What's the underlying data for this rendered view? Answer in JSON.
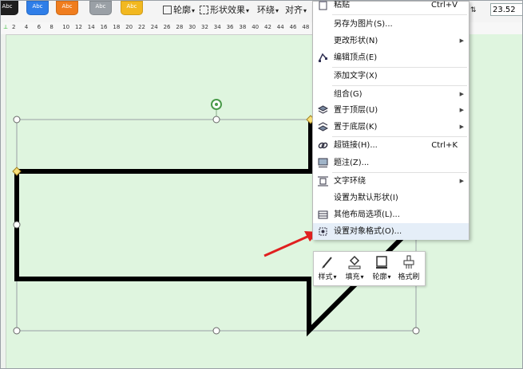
{
  "toolbar": {
    "style_swatches": [
      {
        "label": "Abc",
        "color": "#1e1e1e"
      },
      {
        "label": "Abc",
        "color": "#2f7ee8"
      },
      {
        "label": "Abc",
        "color": "#f07d1e"
      },
      {
        "label": "Abc",
        "color": "#9aa0a6"
      },
      {
        "label": "Abc",
        "color": "#f2b820"
      }
    ],
    "outline_label": "轮廓",
    "shape_effects_label": "形状效果",
    "wrap_label": "环绕",
    "align_label": "对齐",
    "size_value": "23.52"
  },
  "ruler": {
    "ticks": [
      "2",
      "4",
      "6",
      "8",
      "10",
      "12",
      "14",
      "16",
      "18",
      "20",
      "22",
      "24",
      "26",
      "28",
      "30",
      "32",
      "34",
      "36",
      "38",
      "40",
      "42",
      "44",
      "46",
      "48"
    ]
  },
  "context_menu": {
    "items": [
      {
        "label": "粘贴",
        "shortcut": "Ctrl+V",
        "icon": "paste-icon"
      },
      {
        "label": "另存为图片(S)...",
        "shortcut": "",
        "icon": ""
      },
      {
        "label": "更改形状(N)",
        "shortcut": "",
        "icon": "",
        "submenu": true
      },
      {
        "label": "编辑顶点(E)",
        "shortcut": "",
        "icon": "edit-points-icon"
      },
      {
        "label": "添加文字(X)",
        "shortcut": "",
        "icon": ""
      },
      {
        "label": "组合(G)",
        "shortcut": "",
        "icon": "",
        "submenu": true
      },
      {
        "label": "置于顶层(U)",
        "shortcut": "",
        "icon": "bring-to-front-icon",
        "submenu": true
      },
      {
        "label": "置于底层(K)",
        "shortcut": "",
        "icon": "send-to-back-icon",
        "submenu": true
      },
      {
        "label": "超链接(H)...",
        "shortcut": "Ctrl+K",
        "icon": "hyperlink-icon"
      },
      {
        "label": "题注(Z)...",
        "shortcut": "",
        "icon": "caption-icon"
      },
      {
        "label": "文字环绕",
        "shortcut": "",
        "icon": "text-wrap-icon",
        "submenu": true
      },
      {
        "label": "设置为默认形状(I)",
        "shortcut": "",
        "icon": ""
      },
      {
        "label": "其他布局选项(L)...",
        "shortcut": "",
        "icon": "layout-options-icon"
      },
      {
        "label": "设置对象格式(O)...",
        "shortcut": "",
        "icon": "format-object-icon"
      }
    ]
  },
  "float_toolbar": {
    "items": [
      {
        "label": "样式",
        "icon": "style-brush-icon",
        "dropdown": true
      },
      {
        "label": "填充",
        "icon": "fill-bucket-icon",
        "dropdown": true
      },
      {
        "label": "轮廓",
        "icon": "outline-icon",
        "dropdown": true
      },
      {
        "label": "格式刷",
        "icon": "format-painter-icon",
        "dropdown": false
      }
    ]
  },
  "colors": {
    "page_background": "#dff5df",
    "shape_stroke": "#000000",
    "arrow": "#e02020",
    "menu_highlight": "#e5eef8"
  }
}
